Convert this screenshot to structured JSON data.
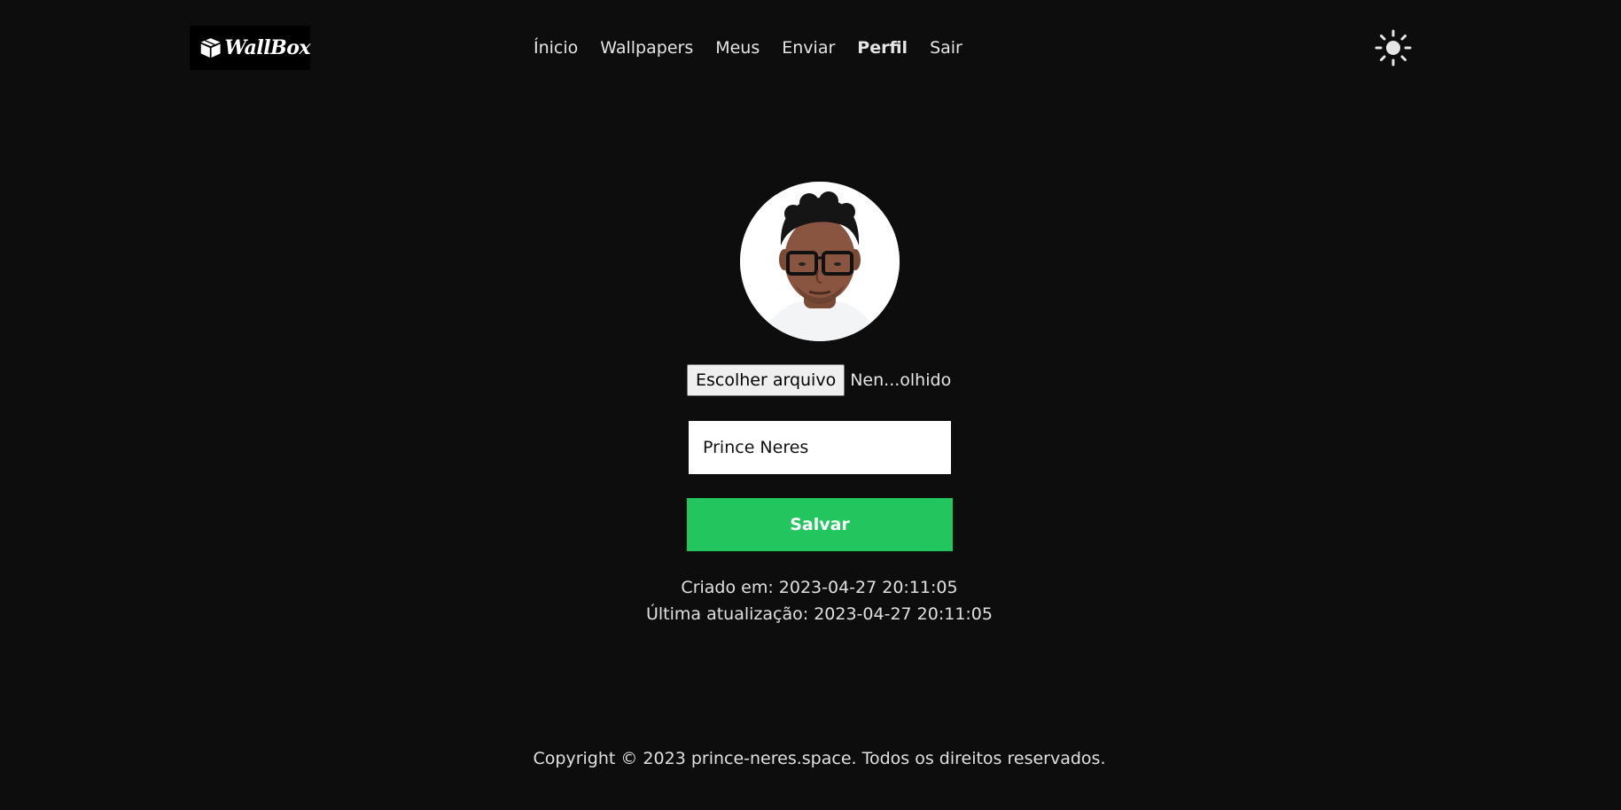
{
  "header": {
    "logo_text": "WallBox",
    "nav": [
      {
        "label": "Ínicio",
        "active": false
      },
      {
        "label": "Wallpapers",
        "active": false
      },
      {
        "label": "Meus",
        "active": false
      },
      {
        "label": "Enviar",
        "active": false
      },
      {
        "label": "Perfil",
        "active": true
      },
      {
        "label": "Sair",
        "active": false
      }
    ],
    "theme_icon": "sun-icon"
  },
  "profile": {
    "file_button_label": "Escolher arquivo",
    "file_status": "Nen...olhido",
    "name_value": "Prince Neres",
    "save_label": "Salvar",
    "created": "Criado em: 2023-04-27 20:11:05",
    "updated": "Última atualização: 2023-04-27 20:11:05"
  },
  "footer": {
    "copyright": "Copyright © 2023 prince-neres.space. Todos os direitos reservados."
  },
  "colors": {
    "background": "#0d0d0d",
    "accent": "#22c55e",
    "text": "#e5e5e5"
  }
}
